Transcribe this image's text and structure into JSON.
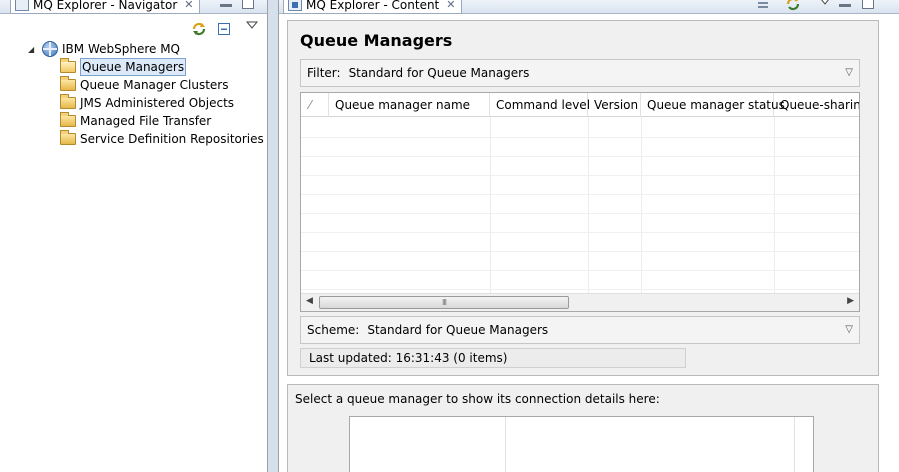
{
  "navigator": {
    "tab_title": "MQ Explorer - Navigator",
    "tree": {
      "root_label": "IBM WebSphere MQ",
      "items": [
        {
          "label": "Queue Managers",
          "selected": true
        },
        {
          "label": "Queue Manager Clusters",
          "selected": false
        },
        {
          "label": "JMS Administered Objects",
          "selected": false
        },
        {
          "label": "Managed File Transfer",
          "selected": false
        },
        {
          "label": "Service Definition Repositories",
          "selected": false
        }
      ]
    },
    "icons": [
      "refresh-icon",
      "collapse-all-icon",
      "view-menu-icon"
    ]
  },
  "content": {
    "tab_title": "MQ Explorer - Content",
    "page_title": "Queue Managers",
    "filter": {
      "label": "Filter:",
      "value": "Standard for Queue Managers"
    },
    "table": {
      "columns": [
        "Queue manager name",
        "Command level",
        "Version",
        "Queue manager status",
        "Queue-sharing"
      ],
      "rows": []
    },
    "scheme": {
      "label": "Scheme:",
      "value": "Standard for Queue Managers"
    },
    "last_updated": "Last updated: 16:31:43 (0 items)",
    "detail_prompt": "Select a queue manager to show its connection details here:"
  },
  "colors": {
    "window_frame": "#d6dfec",
    "selection": "#dce9f8",
    "selection_border": "#7da2ce",
    "panel_bg": "#f0f0f0"
  }
}
